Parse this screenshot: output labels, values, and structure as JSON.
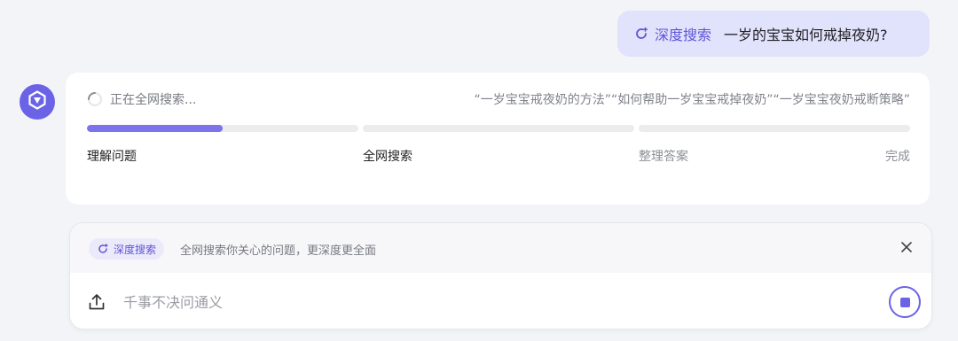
{
  "query": {
    "mode_label": "深度搜索",
    "mode_icon": "deep-search-icon",
    "text": "一岁的宝宝如何戒掉夜奶?"
  },
  "assistant": {
    "avatar_icon": "assistant-logo-icon",
    "status": "正在全网搜索...",
    "keywords": [
      "“一岁宝宝戒夜奶的方法”",
      "“如何帮助一岁宝宝戒掉夜奶”",
      "“一岁宝宝夜奶戒断策略”"
    ],
    "steps": [
      {
        "label": "理解问题",
        "progress": 0.5,
        "state": "done"
      },
      {
        "label": "全网搜索",
        "progress": 0,
        "state": "active"
      },
      {
        "label": "整理答案",
        "progress": 0,
        "state": "pending"
      },
      {
        "label": "完成",
        "state": "pending"
      }
    ]
  },
  "composer": {
    "mode_chip": "深度搜索",
    "mode_description": "全网搜索你关心的问题，更深度更全面",
    "placeholder": "千事不决问通义",
    "upload_icon": "upload-icon",
    "close_icon": "close-icon",
    "stop_icon": "stop-icon"
  },
  "colors": {
    "accent": "#6b63e6",
    "bubble": "#e1e2fb",
    "progress": "#7c74ea",
    "track": "#ececef"
  }
}
